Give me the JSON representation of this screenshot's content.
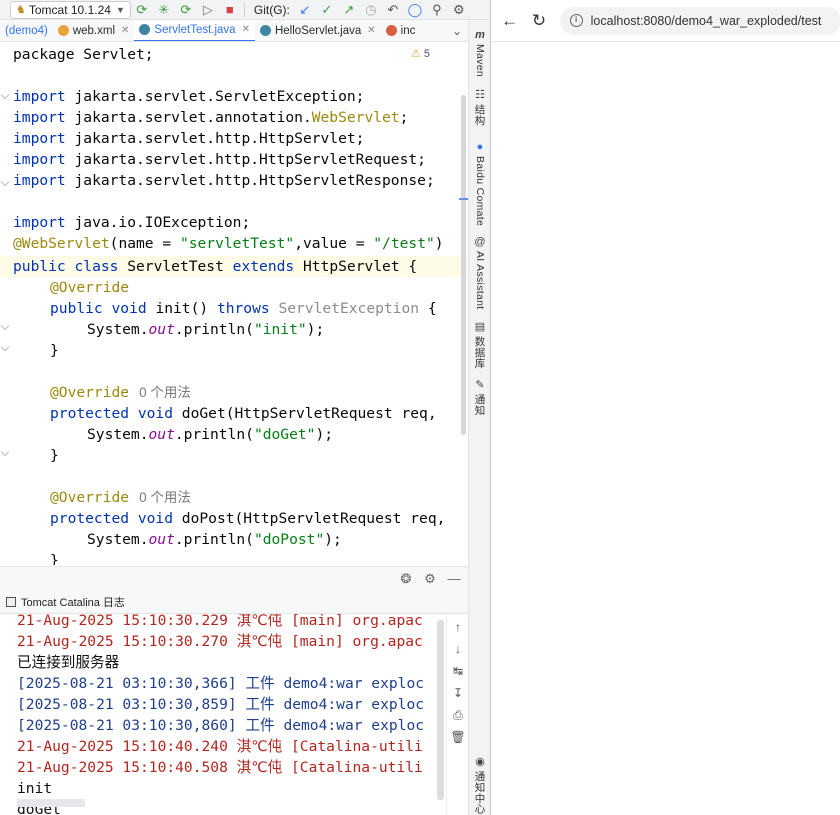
{
  "ide": {
    "run_config": "Tomcat 10.1.24",
    "git_label": "Git(G):",
    "tabs": [
      {
        "label": "(demo4)",
        "icon": "module-icon",
        "color": "#3574f0"
      },
      {
        "label": "web.xml",
        "icon": "xml-file-icon",
        "color": "#e8a33d"
      },
      {
        "label": "ServletTest.java",
        "icon": "java-class-icon",
        "color": "#3e86a0"
      },
      {
        "label": "HelloServlet.java",
        "icon": "java-class-icon",
        "color": "#3e86a0"
      },
      {
        "label": "inc",
        "icon": "jsp-file-icon",
        "color": "#d65f3d"
      }
    ],
    "warning_count": "5",
    "code": {
      "l1": "package Servlet;",
      "l3a": "import",
      "l3b": " jakarta.servlet.ServletException;",
      "l4a": "import",
      "l4b": " jakarta.servlet.annotation.",
      "l4c": "WebServlet",
      "l4d": ";",
      "l5a": "import",
      "l5b": " jakarta.servlet.http.HttpServlet;",
      "l6a": "import",
      "l6b": " jakarta.servlet.http.HttpServletRequest;",
      "l7a": "import",
      "l7b": " jakarta.servlet.http.HttpServletResponse;",
      "l9a": "import",
      "l9b": " java.io.IOException;",
      "l10a": "@WebServlet",
      "l10b": "(name = ",
      "l10c": "\"servletTest\"",
      "l10d": ",value = ",
      "l10e": "\"/test\"",
      "l10f": ")",
      "l11a": "public class",
      "l11b": " ServletTest ",
      "l11c": "extends",
      "l11d": " HttpServlet {",
      "l12": "@Override",
      "l13a": "public void",
      "l13b": " init() ",
      "l13c": "throws",
      "l13d": " ServletException",
      "l13e": " {",
      "l14a": "System.",
      "l14b": "out",
      "l14c": ".println(",
      "l14d": "\"init\"",
      "l14e": ");",
      "l15": "}",
      "l17a": "@Override",
      "l17b": "0 个用法",
      "l18a": "protected void",
      "l18b": " doGet(HttpServletRequest req,",
      "l19a": "System.",
      "l19b": "out",
      "l19c": ".println(",
      "l19d": "\"doGet\"",
      "l19e": ");",
      "l20": "}",
      "l22a": "@Override",
      "l22b": "0 个用法",
      "l23a": "protected void",
      "l23b": " doPost(HttpServletRequest req,",
      "l24a": "System.",
      "l24b": "out",
      "l24c": ".println(",
      "l24d": "\"doPost\"",
      "l24e": ");",
      "l25": "}"
    },
    "side_tools": [
      {
        "label": "Maven",
        "icon": "maven-icon"
      },
      {
        "label": "结构",
        "icon": "structure-icon"
      },
      {
        "label": "Baidu Comate",
        "icon": "comate-icon"
      },
      {
        "label": "AI Assistant",
        "icon": "ai-assistant-icon"
      },
      {
        "label": "数据库",
        "icon": "database-icon"
      },
      {
        "label": "通知",
        "icon": "notifications-icon"
      },
      {
        "label": "通知中心",
        "icon": "notification-bell-icon"
      }
    ],
    "run_panel": {
      "tab_label": "Tomcat Catalina 日志",
      "lines": [
        {
          "a": "21-Aug-2025 15:10:30.229 ",
          "b": "淇℃伅",
          "c": " [main] org.apac",
          "style": "red"
        },
        {
          "a": "21-Aug-2025 15:10:30.270 ",
          "b": "淇℃伅",
          "c": " [main] org.apac",
          "style": "red"
        },
        {
          "a": "",
          "b": "已连接到服务器",
          "c": "",
          "style": "black"
        },
        {
          "a": "[2025-08-21 03:10:30,366] ",
          "b": "工件",
          "c": " demo4:war exploc",
          "style": "blue"
        },
        {
          "a": "[2025-08-21 03:10:30,859] ",
          "b": "工件",
          "c": " demo4:war exploc",
          "style": "blue"
        },
        {
          "a": "[2025-08-21 03:10:30,860] ",
          "b": "工件",
          "c": " demo4:war exploc",
          "style": "blue"
        },
        {
          "a": "21-Aug-2025 15:10:40.240 ",
          "b": "淇℃伅",
          "c": " [Catalina-utili",
          "style": "red"
        },
        {
          "a": "21-Aug-2025 15:10:40.508 ",
          "b": "淇℃伅",
          "c": " [Catalina-utili",
          "style": "red"
        },
        {
          "a": "init",
          "b": "",
          "c": "",
          "style": "black"
        },
        {
          "a": "doGet",
          "b": "",
          "c": "",
          "style": "black"
        }
      ]
    }
  },
  "browser": {
    "url": "localhost:8080/demo4_war_exploded/test"
  }
}
